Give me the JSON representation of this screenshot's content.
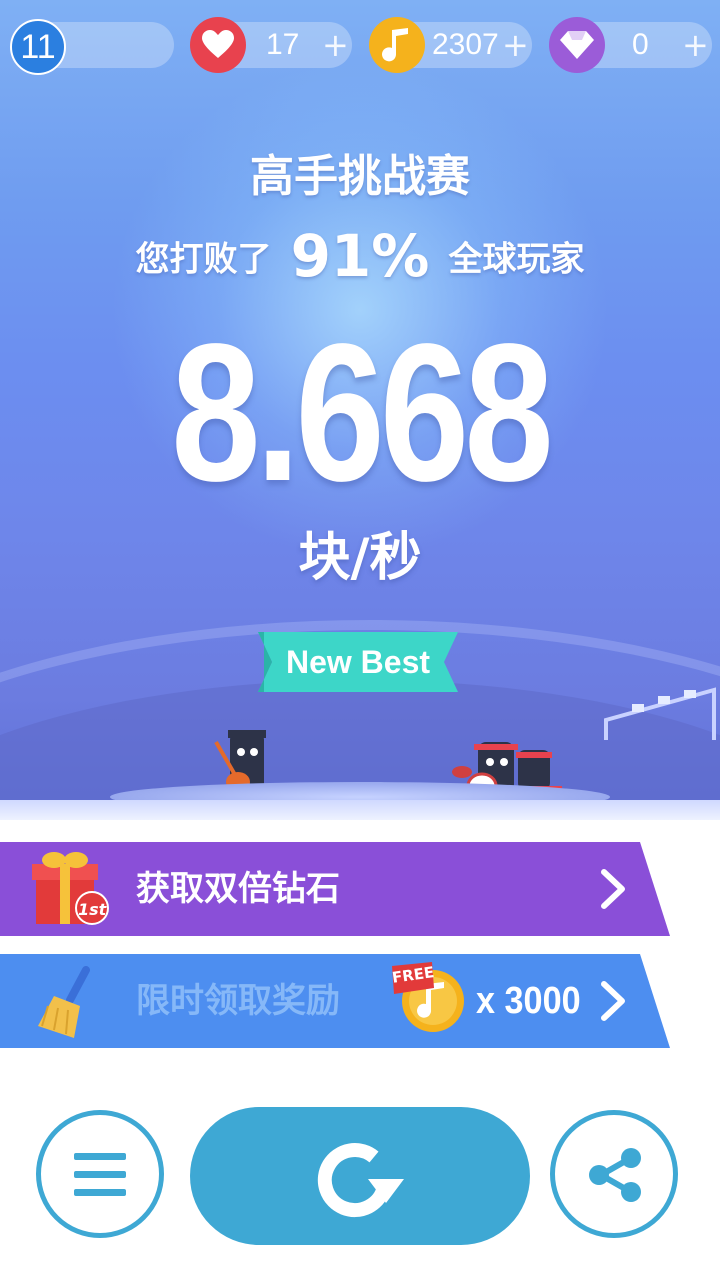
{
  "topbar": {
    "level": "11",
    "lives": "17",
    "notes": "2307",
    "diamonds": "0",
    "plus": "+"
  },
  "result": {
    "title": "高手挑战赛",
    "beat_prefix": "您打败了",
    "beat_percent": "91%",
    "beat_suffix": "全球玩家",
    "score": "8.668",
    "unit": "块/秒",
    "badge": "New Best"
  },
  "rows": {
    "double_diamonds": {
      "label": "获取双倍钻石",
      "badge": "1st"
    },
    "limited_reward": {
      "label": "限时领取奖励",
      "free_badge": "FREE",
      "amount": "x 3000"
    }
  },
  "icons": {
    "level": "level-badge-icon",
    "heart": "heart-icon",
    "note": "music-note-icon",
    "diamond": "diamond-icon",
    "gift": "gift-box-icon",
    "broom": "broom-icon",
    "coin": "music-coin-icon",
    "menu": "menu-icon",
    "replay": "replay-icon",
    "share": "share-icon"
  },
  "colors": {
    "heart": "#e8424e",
    "note": "#f5b21c",
    "diamond": "#9b5cd8",
    "level": "#2b7fe0",
    "purple_row": "#8a4fd8",
    "blue_row": "#4d8ef0",
    "teal": "#3ea8d4",
    "ribbon": "#3dd6c8"
  }
}
